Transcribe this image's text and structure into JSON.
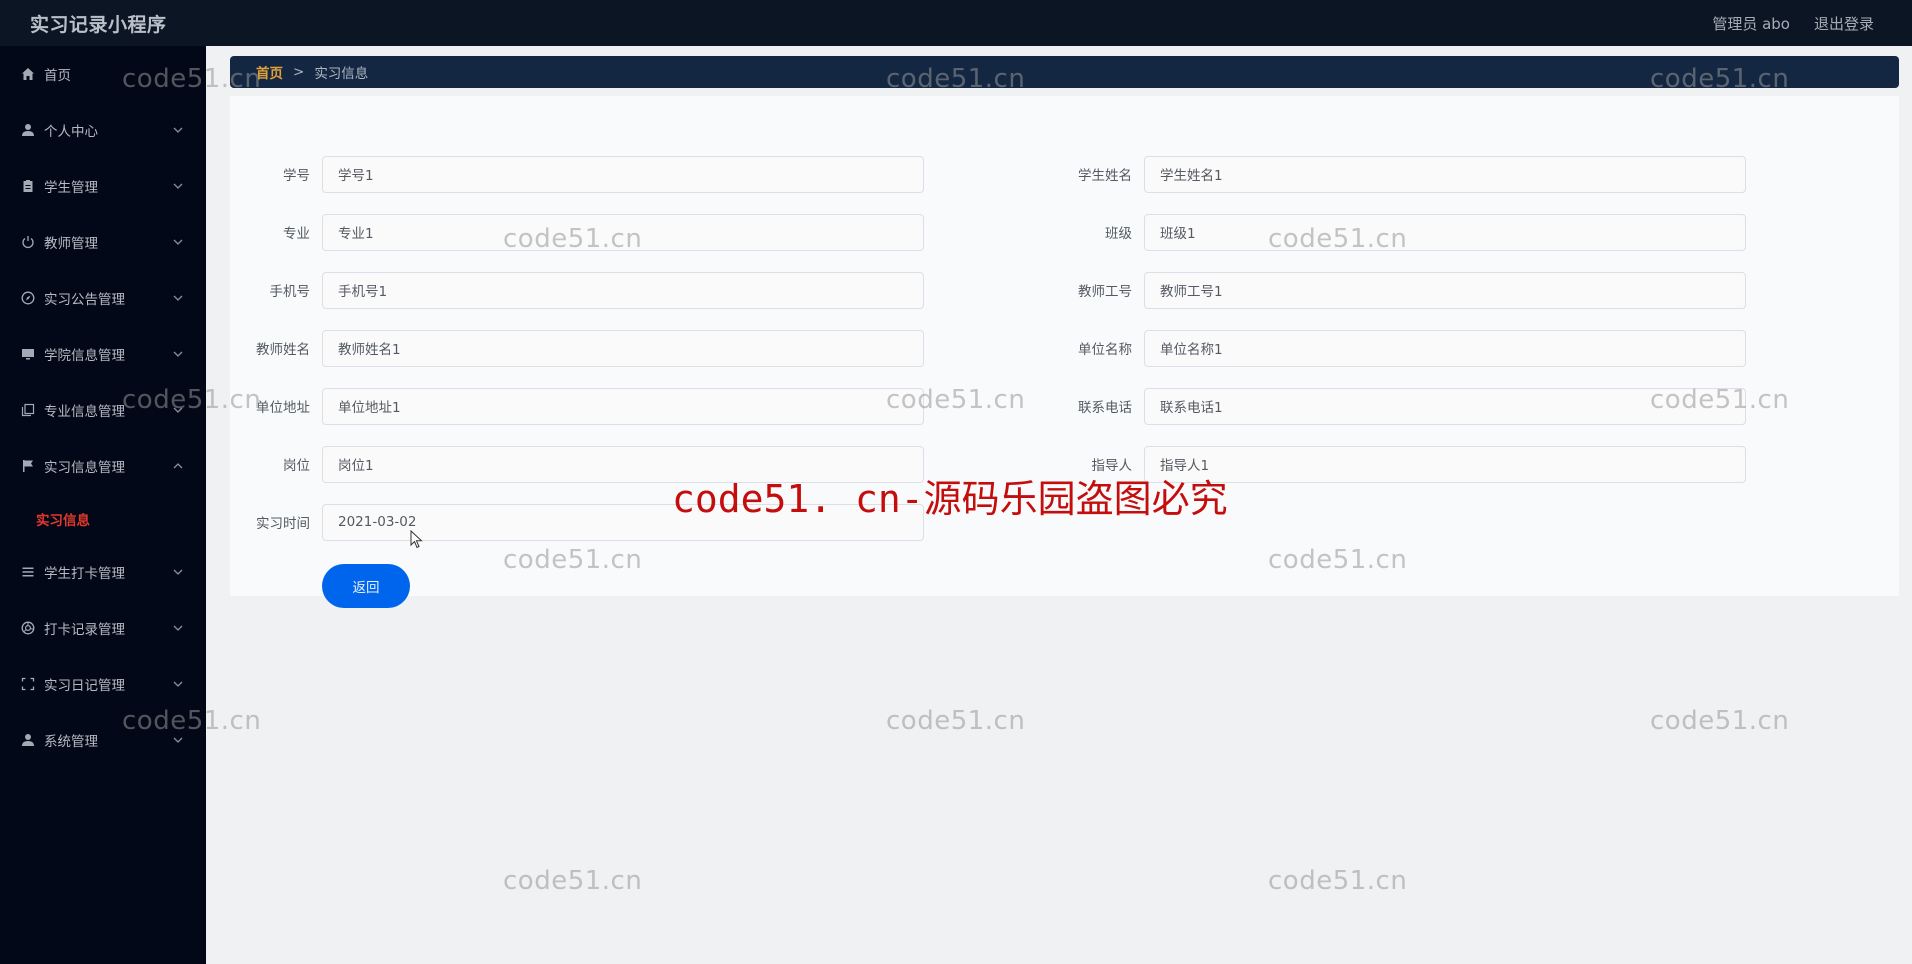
{
  "header": {
    "app_title": "实习记录小程序",
    "user_label": "管理员 abo",
    "logout_label": "退出登录"
  },
  "sidebar": {
    "items": [
      {
        "label": "首页",
        "icon": "home-icon",
        "has_chevron": false
      },
      {
        "label": "个人中心",
        "icon": "user-icon",
        "has_chevron": true
      },
      {
        "label": "学生管理",
        "icon": "clipboard-icon",
        "has_chevron": true
      },
      {
        "label": "教师管理",
        "icon": "power-icon",
        "has_chevron": true
      },
      {
        "label": "实习公告管理",
        "icon": "compass-icon",
        "has_chevron": true
      },
      {
        "label": "学院信息管理",
        "icon": "monitor-icon",
        "has_chevron": true
      },
      {
        "label": "专业信息管理",
        "icon": "copy-icon",
        "has_chevron": true
      },
      {
        "label": "实习信息管理",
        "icon": "flag-icon",
        "has_chevron": true,
        "expanded": true
      },
      {
        "label": "学生打卡管理",
        "icon": "list-icon",
        "has_chevron": true
      },
      {
        "label": "打卡记录管理",
        "icon": "aperture-icon",
        "has_chevron": true
      },
      {
        "label": "实习日记管理",
        "icon": "fullscreen-icon",
        "has_chevron": true
      },
      {
        "label": "系统管理",
        "icon": "user-icon",
        "has_chevron": true
      }
    ],
    "active_subitem": "实习信息",
    "active_color": "#e2382c"
  },
  "breadcrumb": {
    "home": "首页",
    "separator": ">",
    "current": "实习信息"
  },
  "form": {
    "fields": [
      {
        "label": "学号",
        "value": "学号1"
      },
      {
        "label": "学生姓名",
        "value": "学生姓名1"
      },
      {
        "label": "专业",
        "value": "专业1"
      },
      {
        "label": "班级",
        "value": "班级1"
      },
      {
        "label": "手机号",
        "value": "手机号1"
      },
      {
        "label": "教师工号",
        "value": "教师工号1"
      },
      {
        "label": "教师姓名",
        "value": "教师姓名1"
      },
      {
        "label": "单位名称",
        "value": "单位名称1"
      },
      {
        "label": "单位地址",
        "value": "单位地址1"
      },
      {
        "label": "联系电话",
        "value": "联系电话1"
      },
      {
        "label": "岗位",
        "value": "岗位1"
      },
      {
        "label": "指导人",
        "value": "指导人1"
      },
      {
        "label": "实习时间",
        "value": "2021-03-02"
      }
    ],
    "back_button": "返回",
    "button_color": "#0065ed"
  },
  "watermarks": {
    "text": "code51.cn",
    "banner": "code51. cn-源码乐园盗图必究"
  }
}
